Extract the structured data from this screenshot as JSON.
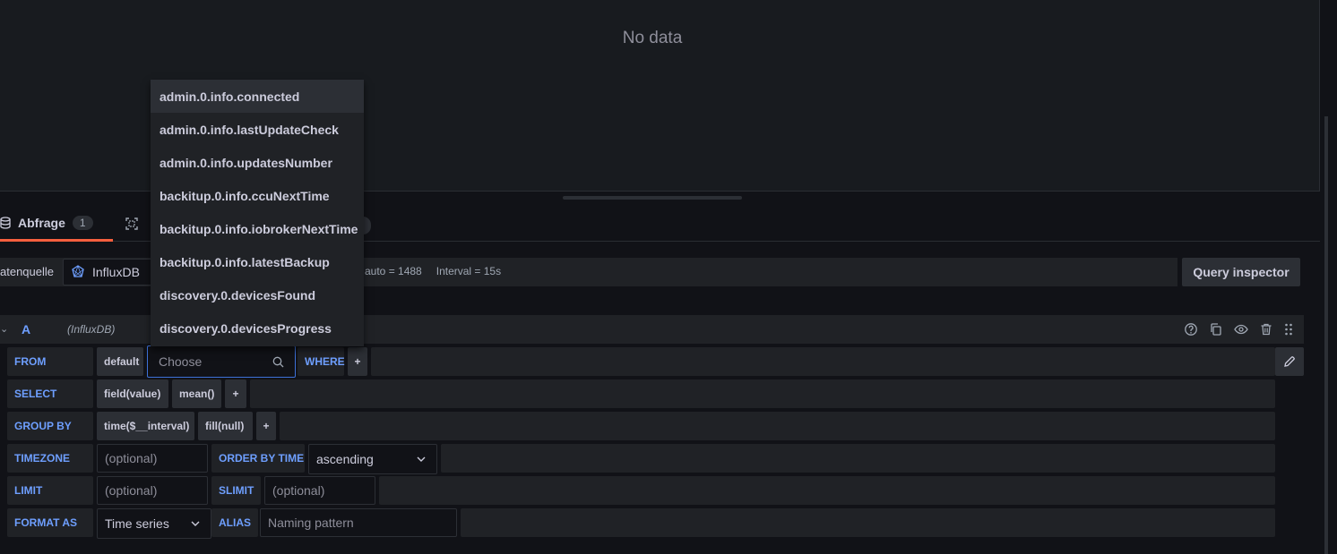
{
  "panel": {
    "no_data": "No data"
  },
  "tabs": {
    "query_label": "Abfrage",
    "query_count": "1"
  },
  "datasource": {
    "label": "atenquelle",
    "name": "InfluxDB",
    "max_data_points": "auto = 1488",
    "interval": "Interval = 15s",
    "inspector_button": "Query inspector"
  },
  "query": {
    "ref": "A",
    "datasource": "(InfluxDB)"
  },
  "editor": {
    "from": {
      "keyword": "FROM",
      "policy": "default",
      "measurement_placeholder": "Choose",
      "where": "WHERE",
      "add": "+"
    },
    "select": {
      "keyword": "SELECT",
      "field": "field(value)",
      "agg": "mean()",
      "add": "+"
    },
    "group_by": {
      "keyword": "GROUP BY",
      "time": "time($__interval)",
      "fill": "fill(null)",
      "add": "+"
    },
    "timezone": {
      "keyword": "TIMEZONE",
      "placeholder": "(optional)",
      "order_keyword": "ORDER BY TIME",
      "order_value": "ascending"
    },
    "limit": {
      "keyword": "LIMIT",
      "placeholder": "(optional)",
      "slimit_keyword": "SLIMIT",
      "slimit_placeholder": "(optional)"
    },
    "format": {
      "keyword": "FORMAT AS",
      "value": "Time series",
      "alias_keyword": "ALIAS",
      "alias_placeholder": "Naming pattern"
    }
  },
  "dropdown": {
    "items": [
      "admin.0.info.connected",
      "admin.0.info.lastUpdateCheck",
      "admin.0.info.updatesNumber",
      "backitup.0.info.ccuNextTime",
      "backitup.0.info.iobrokerNextTime",
      "backitup.0.info.latestBackup",
      "discovery.0.devicesFound",
      "discovery.0.devicesProgress"
    ]
  },
  "colors": {
    "accent": "#6e9fff",
    "tab_underline": "#f55f3e",
    "focus": "#3d71d9"
  },
  "icons": [
    "database-icon",
    "transform-icon",
    "influxdb-logo-icon",
    "help-icon",
    "copy-icon",
    "eye-icon",
    "trash-icon",
    "drag-handle-icon",
    "search-icon",
    "chevron-down-icon",
    "pencil-icon"
  ]
}
